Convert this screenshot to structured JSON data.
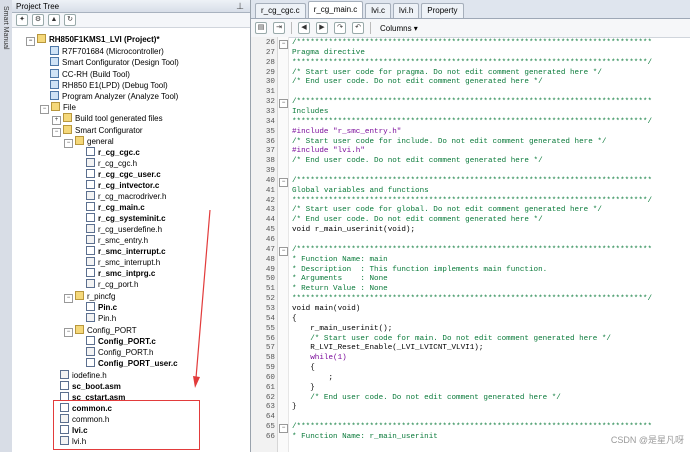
{
  "side_strip": {
    "label": "Smart Manual"
  },
  "panel": {
    "title": "Project Tree",
    "pin": "⊥"
  },
  "tree": {
    "project": "RH850F1KMS1_LVI (Project)*",
    "microcontroller": "R7F701684 (Microcontroller)",
    "smart_config": "Smart Configurator (Design Tool)",
    "build_tool": "CC-RH (Build Tool)",
    "debug_tool": "RH850 E1(LPD) (Debug Tool)",
    "analyze_tool": "Program Analyzer (Analyze Tool)",
    "file": "File",
    "build_gen": "Build tool generated files",
    "sc_folder": "Smart Configurator",
    "general": "general",
    "general_files": [
      "r_cg_cgc.c",
      "r_cg_cgc.h",
      "r_cg_cgc_user.c",
      "r_cg_intvector.c",
      "r_cg_macrodriver.h",
      "r_cg_main.c",
      "r_cg_systeminit.c",
      "r_cg_userdefine.h",
      "r_smc_entry.h",
      "r_smc_interrupt.c",
      "r_smc_interrupt.h",
      "r_smc_intprg.c",
      "r_cg_port.h"
    ],
    "pincfg": "r_pincfg",
    "pincfg_files": [
      "Pin.c",
      "Pin.h"
    ],
    "config_port": "Config_PORT",
    "config_port_files": [
      "Config_PORT.c",
      "Config_PORT.h",
      "Config_PORT_user.c"
    ],
    "root_files": [
      "iodefine.h",
      "sc_boot.asm",
      "sc_cstart.asm",
      "common.c",
      "common.h",
      "lvi.c",
      "lvi.h"
    ]
  },
  "editor": {
    "tabs": [
      "r_cg_cgc.c",
      "r_cg_main.c",
      "lvi.c",
      "lvi.h",
      "Property"
    ],
    "columns_label": "Columns",
    "lines": [
      {
        "n": "26",
        "t": "/******************************************************************************",
        "c": "s"
      },
      {
        "n": "27",
        "t": "Pragma directive",
        "c": "s"
      },
      {
        "n": "28",
        "t": "******************************************************************************/",
        "c": "s"
      },
      {
        "n": "29",
        "t": "/* Start user code for pragma. Do not edit comment generated here */",
        "c": "s"
      },
      {
        "n": "30",
        "t": "/* End user code. Do not edit comment generated here */",
        "c": "s"
      },
      {
        "n": "31",
        "t": "",
        "c": "n"
      },
      {
        "n": "32",
        "t": "/******************************************************************************",
        "c": "s"
      },
      {
        "n": "33",
        "t": "Includes",
        "c": "s"
      },
      {
        "n": "34",
        "t": "******************************************************************************/",
        "c": "s"
      },
      {
        "n": "35",
        "t": "#include \"r_smc_entry.h\"",
        "c": "k"
      },
      {
        "n": "36",
        "t": "/* Start user code for include. Do not edit comment generated here */",
        "c": "s"
      },
      {
        "n": "37",
        "t": "#include \"lvi.h\"",
        "c": "k"
      },
      {
        "n": "38",
        "t": "/* End user code. Do not edit comment generated here */",
        "c": "s"
      },
      {
        "n": "39",
        "t": "",
        "c": "n"
      },
      {
        "n": "40",
        "t": "/******************************************************************************",
        "c": "s"
      },
      {
        "n": "41",
        "t": "Global variables and functions",
        "c": "s"
      },
      {
        "n": "42",
        "t": "******************************************************************************/",
        "c": "s"
      },
      {
        "n": "43",
        "t": "/* Start user code for global. Do not edit comment generated here */",
        "c": "s"
      },
      {
        "n": "44",
        "t": "/* End user code. Do not edit comment generated here */",
        "c": "s"
      },
      {
        "n": "45",
        "t": "void r_main_userinit(void);",
        "c": "n"
      },
      {
        "n": "46",
        "t": "",
        "c": "n"
      },
      {
        "n": "47",
        "t": "/******************************************************************************",
        "c": "s"
      },
      {
        "n": "48",
        "t": "* Function Name: main",
        "c": "s"
      },
      {
        "n": "49",
        "t": "* Description  : This function implements main function.",
        "c": "s"
      },
      {
        "n": "50",
        "t": "* Arguments    : None",
        "c": "s"
      },
      {
        "n": "51",
        "t": "* Return Value : None",
        "c": "s"
      },
      {
        "n": "52",
        "t": "******************************************************************************/",
        "c": "s"
      },
      {
        "n": "53",
        "t": "void main(void)",
        "c": "n"
      },
      {
        "n": "54",
        "t": "{",
        "c": "n"
      },
      {
        "n": "55",
        "t": "    r_main_userinit();",
        "c": "n"
      },
      {
        "n": "56",
        "t": "    /* Start user code for main. Do not edit comment generated here */",
        "c": "s"
      },
      {
        "n": "57",
        "t": "    R_LVI_Reset_Enable(_LVI_LVICNT_VLVI1);",
        "c": "n"
      },
      {
        "n": "58",
        "t": "    while(1)",
        "c": "k"
      },
      {
        "n": "59",
        "t": "    {",
        "c": "n"
      },
      {
        "n": "60",
        "t": "        ;",
        "c": "n"
      },
      {
        "n": "61",
        "t": "    }",
        "c": "n"
      },
      {
        "n": "62",
        "t": "    /* End user code. Do not edit comment generated here */",
        "c": "s"
      },
      {
        "n": "63",
        "t": "}",
        "c": "n"
      },
      {
        "n": "64",
        "t": "",
        "c": "n"
      },
      {
        "n": "65",
        "t": "/******************************************************************************",
        "c": "s"
      },
      {
        "n": "66",
        "t": "* Function Name: r_main_userinit",
        "c": "s"
      }
    ]
  },
  "watermark": "CSDN @是星凡呀"
}
